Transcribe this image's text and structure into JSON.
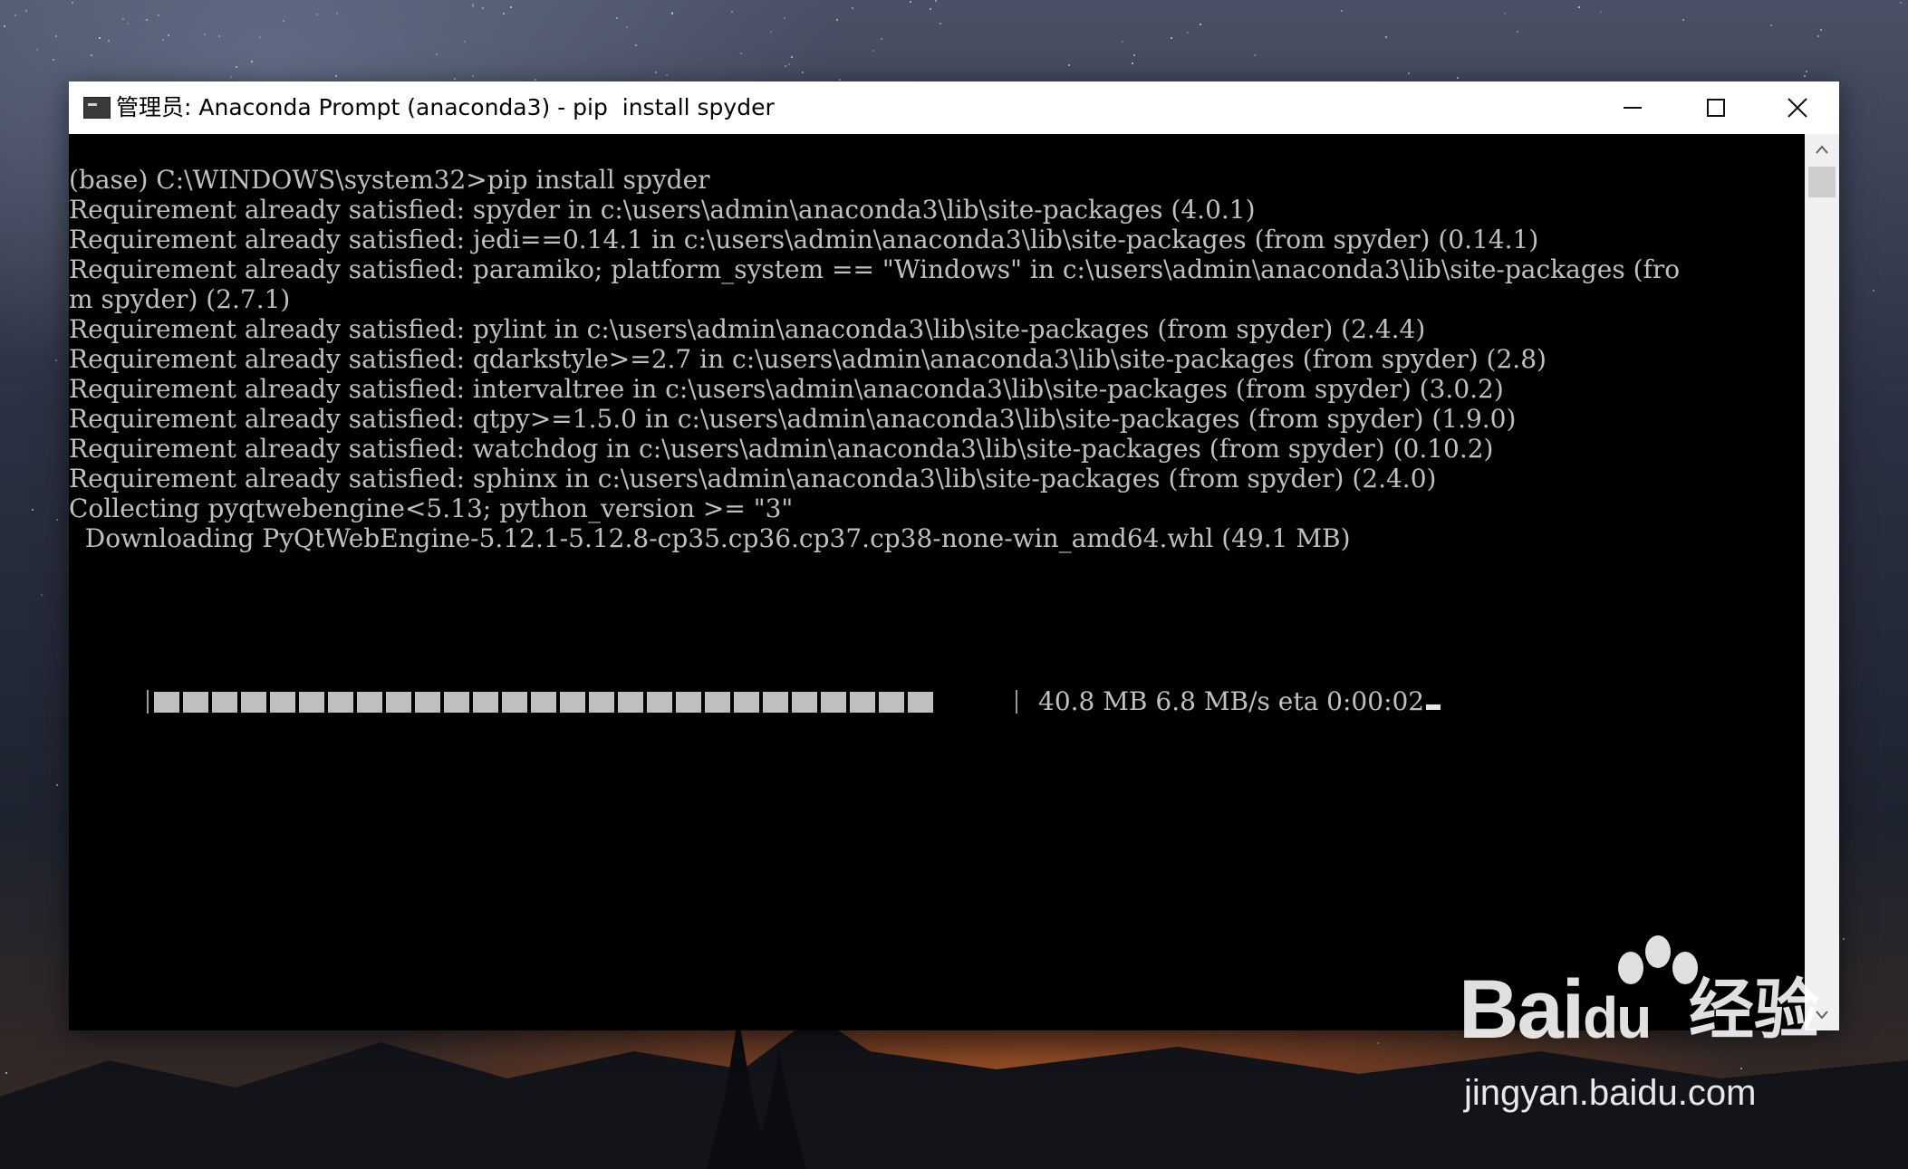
{
  "window": {
    "title": "管理员: Anaconda Prompt (anaconda3) - pip  install spyder"
  },
  "console": {
    "lines": [
      "(base) C:\\WINDOWS\\system32>pip install spyder",
      "Requirement already satisfied: spyder in c:\\users\\admin\\anaconda3\\lib\\site-packages (4.0.1)",
      "Requirement already satisfied: jedi==0.14.1 in c:\\users\\admin\\anaconda3\\lib\\site-packages (from spyder) (0.14.1)",
      "Requirement already satisfied: paramiko; platform_system == \"Windows\" in c:\\users\\admin\\anaconda3\\lib\\site-packages (fro",
      "m spyder) (2.7.1)",
      "Requirement already satisfied: pylint in c:\\users\\admin\\anaconda3\\lib\\site-packages (from spyder) (2.4.4)",
      "Requirement already satisfied: qdarkstyle>=2.7 in c:\\users\\admin\\anaconda3\\lib\\site-packages (from spyder) (2.8)",
      "Requirement already satisfied: intervaltree in c:\\users\\admin\\anaconda3\\lib\\site-packages (from spyder) (3.0.2)",
      "Requirement already satisfied: qtpy>=1.5.0 in c:\\users\\admin\\anaconda3\\lib\\site-packages (from spyder) (1.9.0)",
      "Requirement already satisfied: watchdog in c:\\users\\admin\\anaconda3\\lib\\site-packages (from spyder) (0.10.2)",
      "Requirement already satisfied: sphinx in c:\\users\\admin\\anaconda3\\lib\\site-packages (from spyder) (2.4.0)",
      "Collecting pyqtwebengine<5.13; python_version >= \"3\"",
      "  Downloading PyQtWebEngine-5.12.1-5.12.8-cp35.cp36.cp37.cp38-none-win_amd64.whl (49.1 MB)"
    ],
    "progress": {
      "fraction": 0.83,
      "status": "40.8 MB 6.8 MB/s eta 0:00:02"
    }
  },
  "watermark": {
    "brand": "Bai",
    "brand_du": "du",
    "product": "经验",
    "url": "jingyan.baidu.com"
  },
  "colors": {
    "console_bg": "#000000",
    "console_fg": "#c0c0c0",
    "titlebar_bg": "#ffffff"
  }
}
